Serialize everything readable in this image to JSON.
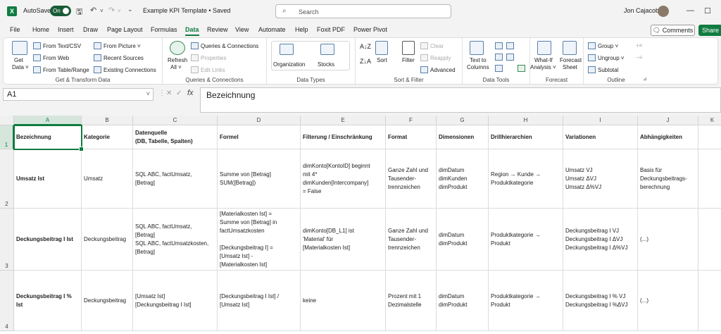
{
  "titlebar": {
    "app_badge": "X",
    "autosave_label": "AutoSave",
    "autosave_state": "On",
    "doc_title": "Example KPI Template • Saved",
    "search_placeholder": "Search",
    "user_name": "Jon Cajacob"
  },
  "menu": {
    "tabs": [
      "File",
      "Home",
      "Insert",
      "Draw",
      "Page Layout",
      "Formulas",
      "Data",
      "Review",
      "View",
      "Automate",
      "Help",
      "Foxit PDF",
      "Power Pivot"
    ],
    "active": "Data",
    "comments": "Comments",
    "share": "Share"
  },
  "ribbon": {
    "get_transform": {
      "label": "Get & Transform Data",
      "get_data": "Get",
      "get_data2": "Data ˅",
      "from_text_csv": "From Text/CSV",
      "from_web": "From Web",
      "from_table_range": "From Table/Range",
      "from_picture": "From Picture ˅",
      "recent_sources": "Recent Sources",
      "existing_connections": "Existing Connections"
    },
    "queries": {
      "label": "Queries & Connections",
      "refresh_all": "Refresh",
      "refresh_all2": "All ˅",
      "queries_connections": "Queries & Connections",
      "properties": "Properties",
      "edit_links": "Edit Links"
    },
    "data_types": {
      "label": "Data Types",
      "organization": "Organization",
      "stocks": "Stocks"
    },
    "sort_filter": {
      "label": "Sort & Filter",
      "sort": "Sort",
      "filter": "Filter",
      "clear": "Clear",
      "reapply": "Reapply",
      "advanced": "Advanced"
    },
    "data_tools": {
      "label": "Data Tools",
      "text_to_columns": "Text to",
      "text_to_columns2": "Columns"
    },
    "forecast": {
      "label": "Forecast",
      "what_if": "What-If",
      "what_if2": "Analysis ˅",
      "forecast_sheet": "Forecast",
      "forecast_sheet2": "Sheet"
    },
    "outline": {
      "label": "Outline",
      "group": "Group ˅",
      "ungroup": "Ungroup ˅",
      "subtotal": "Subtotal"
    }
  },
  "formula_bar": {
    "name_box": "A1",
    "fx": "fx",
    "content": "Bezeichnung"
  },
  "sheet": {
    "columns": [
      "A",
      "B",
      "C",
      "D",
      "E",
      "F",
      "G",
      "H",
      "I",
      "J",
      "K"
    ],
    "selected_column": "A",
    "rows": [
      {
        "num": "1",
        "cells": [
          "Bezeichnung",
          "Kategorie",
          "Datenquelle\n(DB, Tabelle, Spalten)",
          "Formel",
          "Filterung / Einschränkung",
          "Format",
          "Dimensionen",
          "Drillhierarchien",
          "Variationen",
          "Abhängigkeiten",
          ""
        ]
      },
      {
        "num": "2",
        "cells": [
          "Umsatz Ist",
          "Umsatz",
          "SQL ABC, factUmsatz,\n[Betrag]",
          "Summe von [Betrag]\nSUM([Betrag])",
          "dimKonto[KontoID] beginnt\nmit 4*\ndimKunden[Intercompany]\n= False",
          "Ganze Zahl und\nTausender-\ntrennzeichen",
          "dimDatum\ndimKunden\ndimProdukt",
          "Region → Kunde →\nProduktkategorie",
          "Umsatz VJ\nUmsatz ΔVJ\nUmsatz Δ%VJ",
          "Basis für\nDeckungsbeitrags-\nberechnung",
          ""
        ]
      },
      {
        "num": "3",
        "cells": [
          "Deckungsbeitrag I Ist",
          "Deckungsbeitrag",
          "SQL ABC, factUmsatz,\n[Betrag]\nSQL ABC, factUmsatzkosten,\n[Betrag]",
          "[Materialkosten Ist] =\nSumme von [Betrag] in\nfactUmsatzkosten\n\n[Deckungsbeitrag I] =\n[Umsatz Ist] -\n[Materialkosten Ist]",
          "dimKonto[DB_L1] ist\n'Material' für\n[Materialkosten Ist]",
          "Ganze Zahl und\nTausender-\ntrennzeichen",
          "dimDatum\ndimProdukt",
          "Produktkategorie →\nProdukt",
          "Deckungsbeitrag I VJ\nDeckungsbeitrag I ΔVJ\nDeckungsbeitrag I Δ%VJ",
          "(...)",
          ""
        ]
      },
      {
        "num": "4",
        "cells": [
          "Deckungsbeitrag I %\nIst",
          "Deckungsbeitrag",
          "[Umsatz Ist]\n[Deckungsbeitrag I Ist]",
          "[Deckungsbeitrag I Ist] /\n[Umsatz Ist]",
          "keine",
          "Prozent mit 1\nDezimalstelle",
          "dimDatum\ndimProdukt",
          "Produktkategorie →\nProdukt",
          "Deckungsbeitrag I % VJ\nDeckungsbeitrag I %ΔVJ",
          "(...)",
          ""
        ]
      }
    ]
  }
}
